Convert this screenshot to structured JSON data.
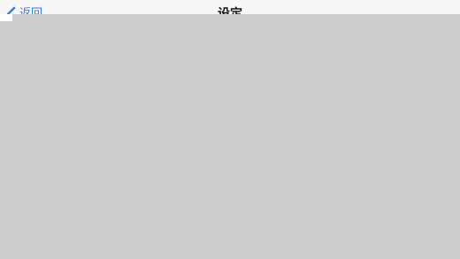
{
  "nav": {
    "back_label": "返回",
    "title": "设定"
  },
  "colors": {
    "accent": "#2a7cff",
    "overlay": "#cccccc",
    "nav_background": "#f7f7f7"
  },
  "icons": {
    "back": "chevron-left-icon"
  }
}
